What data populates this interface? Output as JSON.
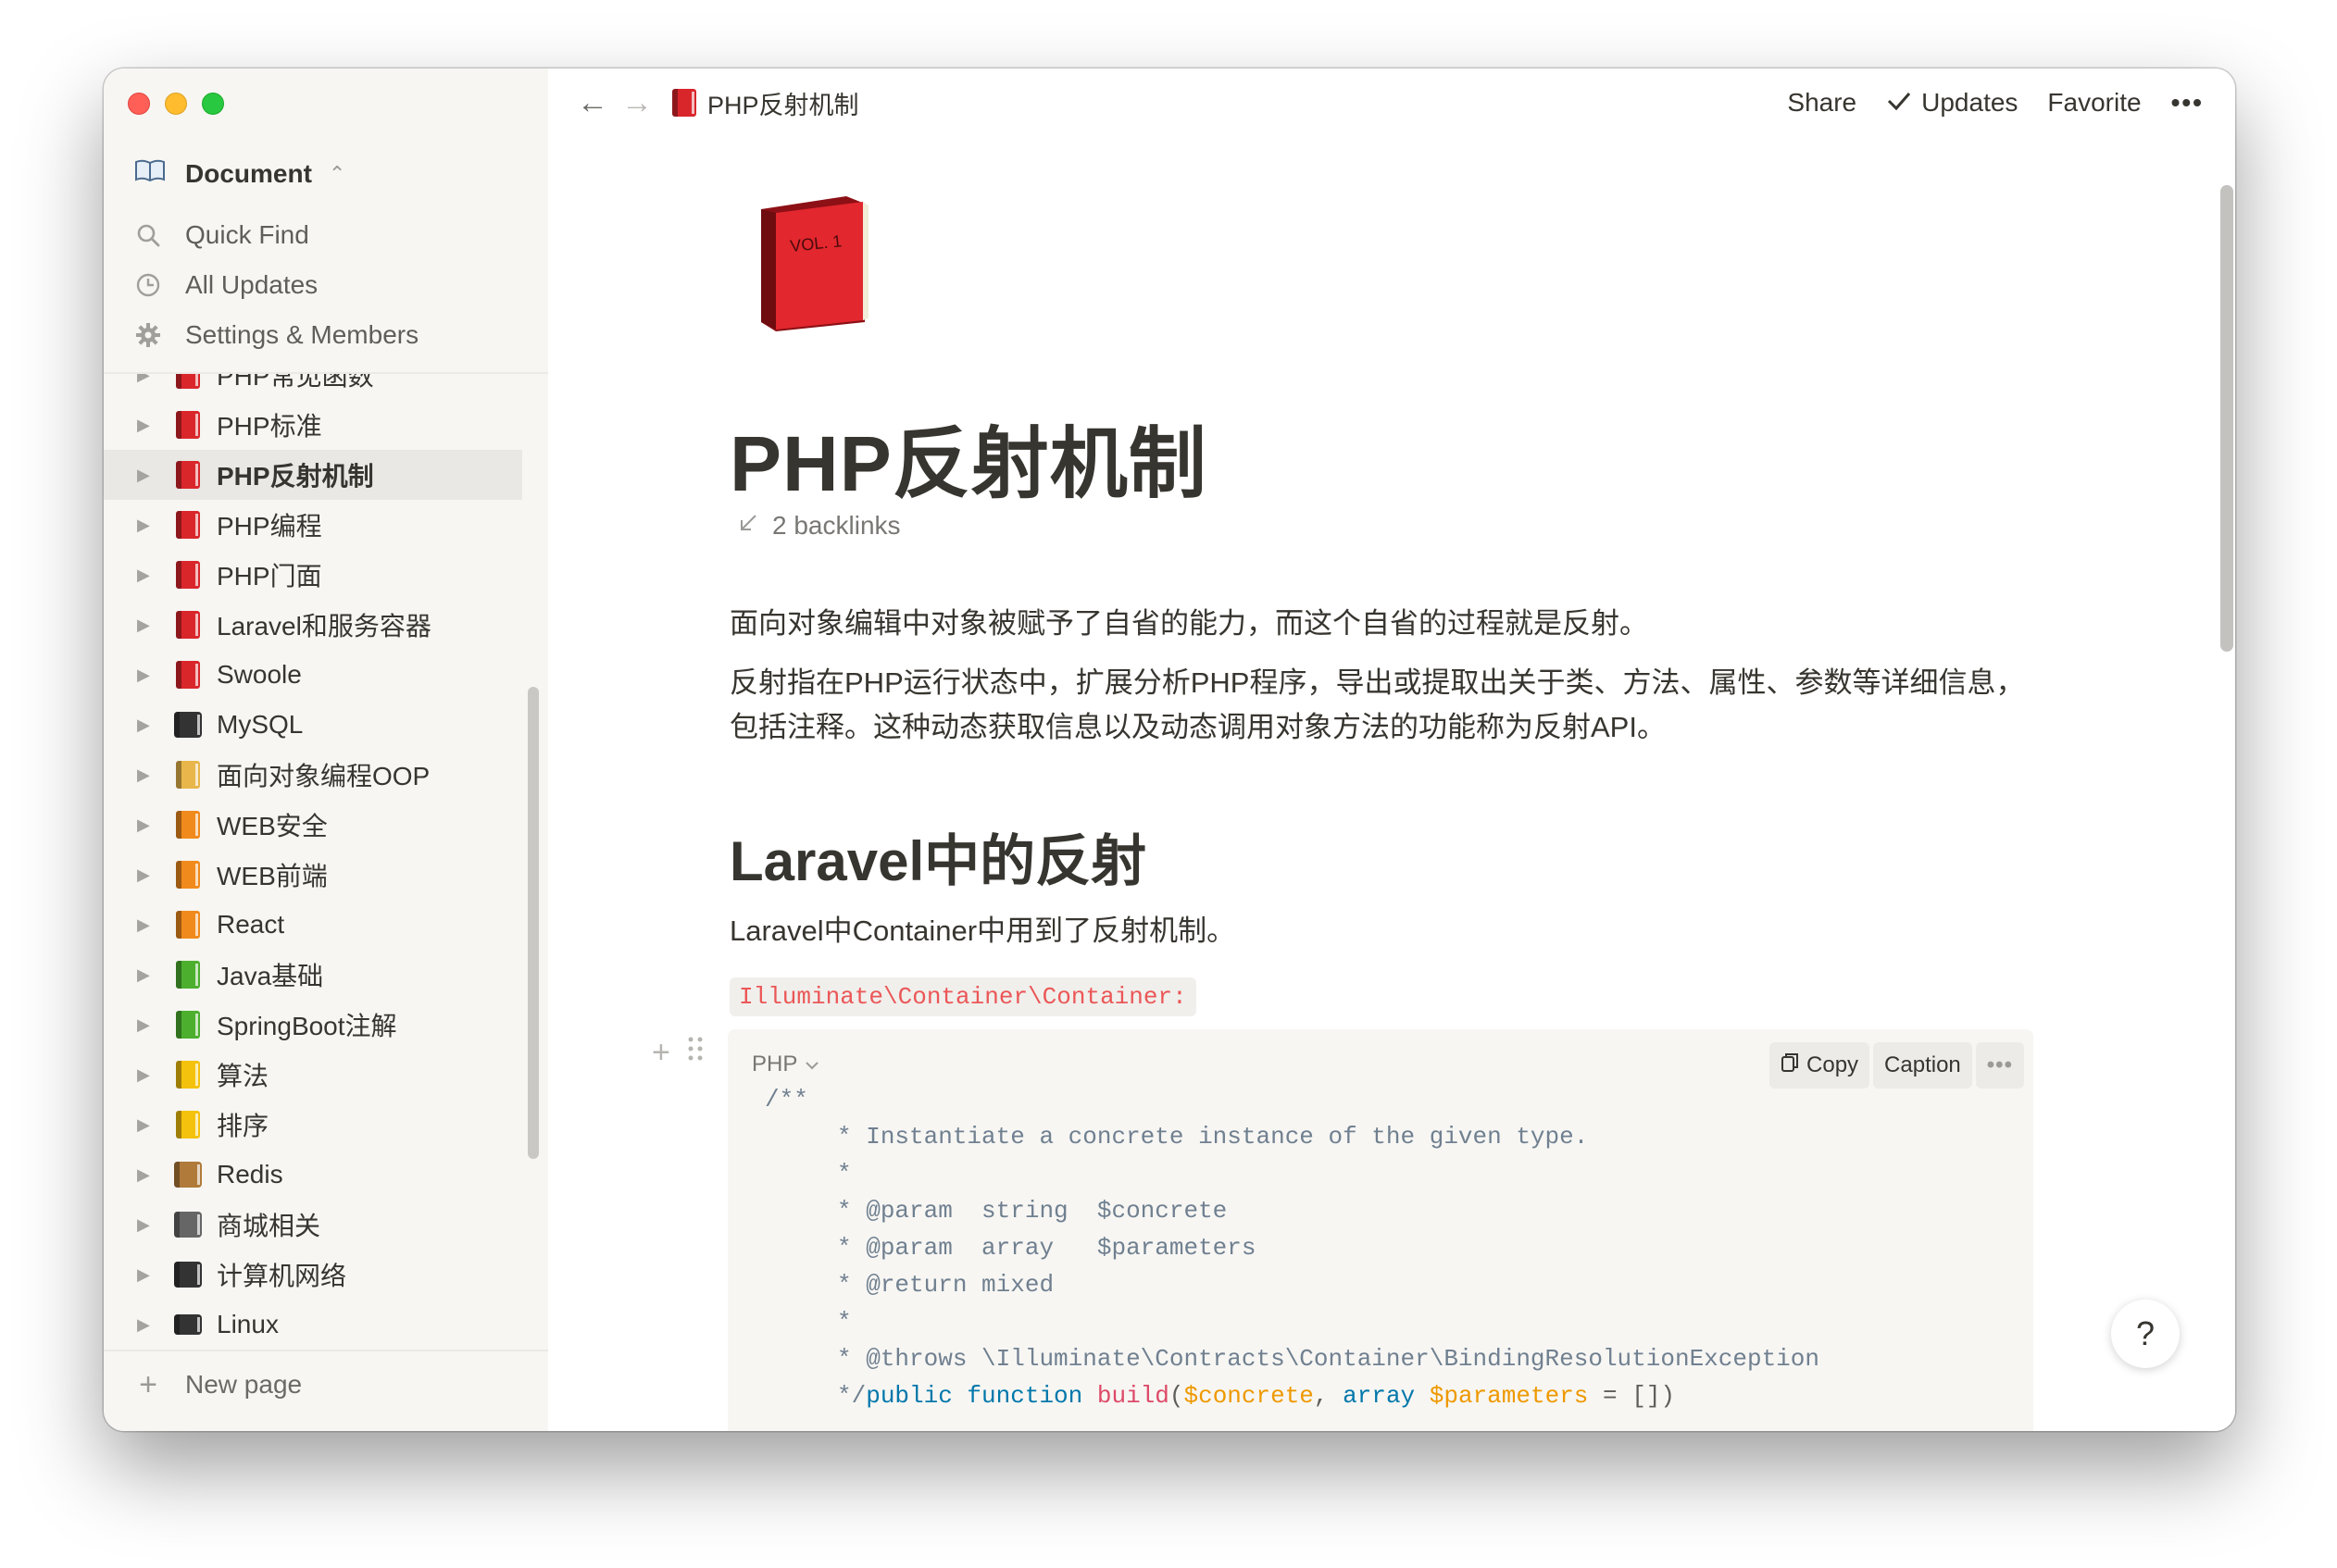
{
  "window": {
    "traffic_lights": [
      "close",
      "minimize",
      "zoom"
    ]
  },
  "sidebar": {
    "workspace": {
      "icon": "open-book-icon",
      "name": "Document"
    },
    "nav": [
      {
        "icon": "search-icon",
        "label": "Quick Find"
      },
      {
        "icon": "clock-icon",
        "label": "All Updates"
      },
      {
        "icon": "gear-icon",
        "label": "Settings & Members"
      }
    ],
    "tree": [
      {
        "label": "PHP常见函数",
        "icon": "red-book",
        "color": "#d9262b"
      },
      {
        "label": "PHP标准",
        "icon": "red-book",
        "color": "#d9262b"
      },
      {
        "label": "PHP反射机制",
        "icon": "red-book",
        "color": "#d9262b",
        "active": true
      },
      {
        "label": "PHP编程",
        "icon": "red-book",
        "color": "#d9262b"
      },
      {
        "label": "PHP门面",
        "icon": "red-book",
        "color": "#d9262b"
      },
      {
        "label": "Laravel和服务容器",
        "icon": "red-book",
        "color": "#d9262b"
      },
      {
        "label": "Swoole",
        "icon": "red-book",
        "color": "#d9262b"
      },
      {
        "label": "MySQL",
        "icon": "floppy-disk",
        "color": "#333333"
      },
      {
        "label": "面向对象编程OOP",
        "icon": "ledger",
        "color": "#e8b64a"
      },
      {
        "label": "WEB安全",
        "icon": "orange-book",
        "color": "#f08a1c"
      },
      {
        "label": "WEB前端",
        "icon": "orange-book",
        "color": "#f08a1c"
      },
      {
        "label": "React",
        "icon": "orange-book",
        "color": "#f08a1c"
      },
      {
        "label": "Java基础",
        "icon": "green-book",
        "color": "#4caf2e"
      },
      {
        "label": "SpringBoot注解",
        "icon": "green-book",
        "color": "#4caf2e"
      },
      {
        "label": "算法",
        "icon": "yellow-notebook",
        "color": "#f4c20d"
      },
      {
        "label": "排序",
        "icon": "yellow-notebook",
        "color": "#f4c20d"
      },
      {
        "label": "Redis",
        "icon": "package",
        "color": "#b07a3a"
      },
      {
        "label": "商城相关",
        "icon": "shopping-cart",
        "color": "#666666"
      },
      {
        "label": "计算机网络",
        "icon": "desktop-computer",
        "color": "#333333"
      },
      {
        "label": "Linux",
        "icon": "laptop",
        "color": "#333333"
      }
    ],
    "new_page": "New page"
  },
  "topbar": {
    "breadcrumb": "PHP反射机制",
    "share": "Share",
    "updates": "Updates",
    "favorite": "Favorite"
  },
  "page": {
    "icon": "red-book-icon",
    "title": "PHP反射机制",
    "backlinks": "2 backlinks",
    "intro_1": "面向对象编辑中对象被赋予了自省的能力，而这个自省的过程就是反射。",
    "intro_2": "反射指在PHP运行状态中，扩展分析PHP程序，导出或提取出关于类、方法、属性、参数等详细信息，包括注释。这种动态获取信息以及动态调用对象方法的功能称为反射API。",
    "heading_2": "Laravel中的反射",
    "para_3": "Laravel中Container中用到了反射机制。",
    "inline_code": "Illuminate\\Container\\Container:",
    "code": {
      "language": "PHP",
      "copy": "Copy",
      "caption": "Caption",
      "lines": [
        "/**",
        "     * Instantiate a concrete instance of the given type.",
        "     *",
        "     * @param  string  $concrete",
        "     * @param  array   $parameters",
        "     * @return mixed",
        "     *",
        "     * @throws \\Illuminate\\Contracts\\Container\\BindingResolutionException",
        "     */public function build($concrete, array $parameters = [])"
      ]
    },
    "help": "?"
  }
}
